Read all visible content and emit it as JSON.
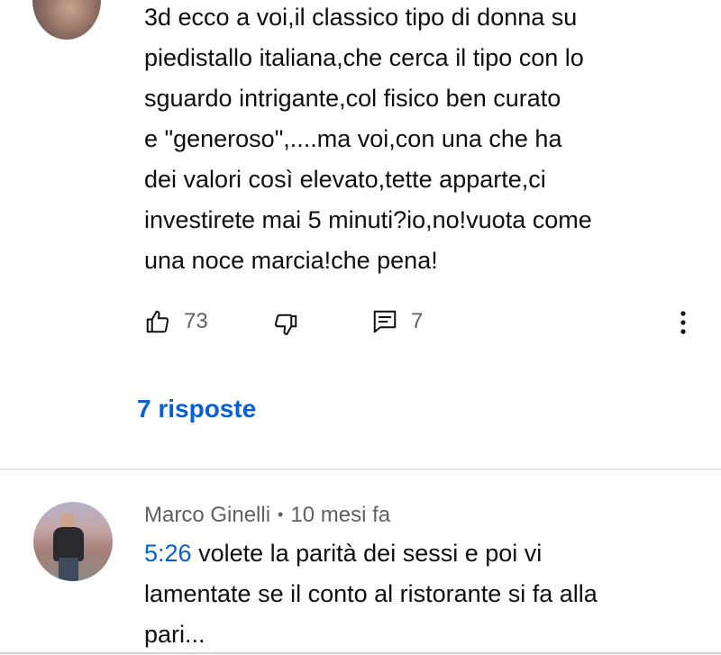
{
  "comments": [
    {
      "avatar": "avatar-photo",
      "text": "3d ecco a voi,il classico tipo di donna su piedistallo italiana,che cerca il tipo con lo sguardo intrigante,col fisico ben curato e \"generoso\",....ma voi,con una che ha dei valori così elevato,tette apparte,ci investirete mai 5 minuti?io,no!vuota come una noce marcia!che pena!",
      "lines": [
        "3d ecco a voi,il classico tipo di donna su",
        "piedistallo italiana,che cerca il tipo con lo",
        "sguardo intrigante,col fisico ben curato",
        "e \"generoso\",....ma voi,con una che ha",
        "dei valori così elevato,tette apparte,ci",
        "investirete mai 5 minuti?io,no!vuota come",
        "una noce marcia!che pena!"
      ],
      "likes": "73",
      "reply_count": "7",
      "replies_link": "7 risposte",
      "icons": {
        "like": "thumbs-up-icon",
        "dislike": "thumbs-down-icon",
        "reply": "comment-icon",
        "more": "more-vert-icon"
      }
    },
    {
      "author": "Marco Ginelli",
      "separator": "•",
      "time": "10 mesi fa",
      "timestamp_link": "5:26",
      "lines": [
        " volete la parità dei sessi e poi vi",
        "lamentate se il conto al ristorante si fa alla",
        "pari..."
      ]
    }
  ],
  "colors": {
    "text": "#0f0f0f",
    "secondary": "#606060",
    "link": "#065fd4",
    "divider": "#e5e5e5"
  }
}
